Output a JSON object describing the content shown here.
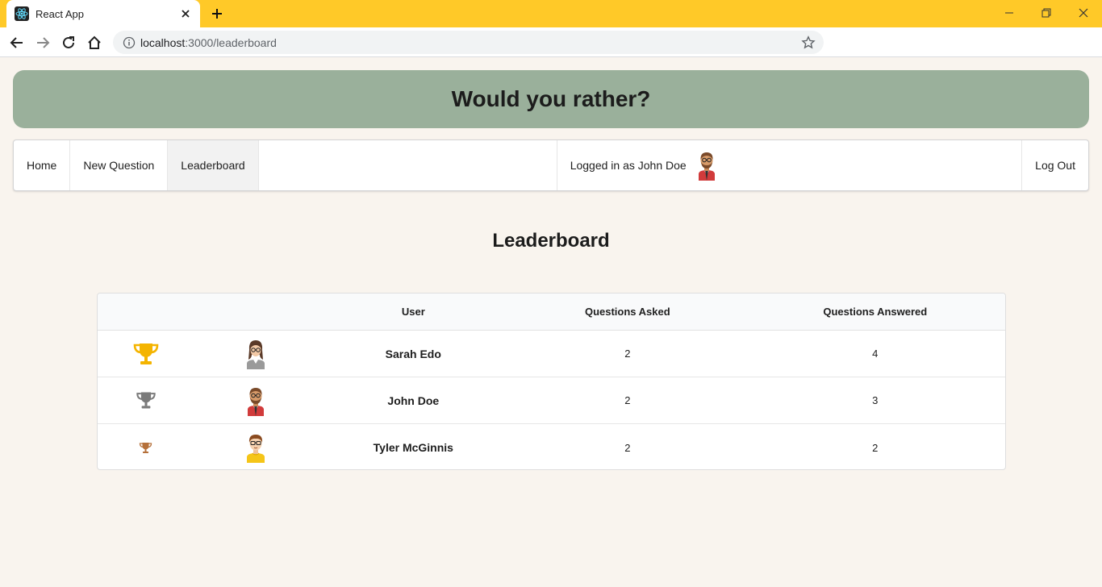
{
  "browser": {
    "tab_title": "React App",
    "url_host": "localhost",
    "url_path": ":3000/leaderboard"
  },
  "app": {
    "banner_title": "Would you rather?"
  },
  "nav": {
    "home": "Home",
    "new_question": "New Question",
    "leaderboard": "Leaderboard",
    "active": "Leaderboard",
    "logged_in_text": "Logged in as John Doe",
    "logout": "Log Out"
  },
  "page": {
    "heading": "Leaderboard"
  },
  "table": {
    "headers": [
      "",
      "",
      "User",
      "Questions Asked",
      "Questions Answered"
    ],
    "rows": [
      {
        "rank_icon": "trophy-gold-icon",
        "avatar": "avatar-woman-glasses",
        "user": "Sarah Edo",
        "asked": "2",
        "answered": "4"
      },
      {
        "rank_icon": "trophy-silver-icon",
        "avatar": "avatar-man-beard",
        "user": "John Doe",
        "asked": "2",
        "answered": "3"
      },
      {
        "rank_icon": "trophy-bronze-icon",
        "avatar": "avatar-man-glasses",
        "user": "Tyler McGinnis",
        "asked": "2",
        "answered": "2"
      }
    ]
  },
  "colors": {
    "tabbar": "#ffc928",
    "banner": "#9ab09b",
    "page_bg": "#f9f4ee",
    "gold": "#f4b400",
    "silver": "#7a7a7a",
    "bronze": "#b5703a"
  }
}
